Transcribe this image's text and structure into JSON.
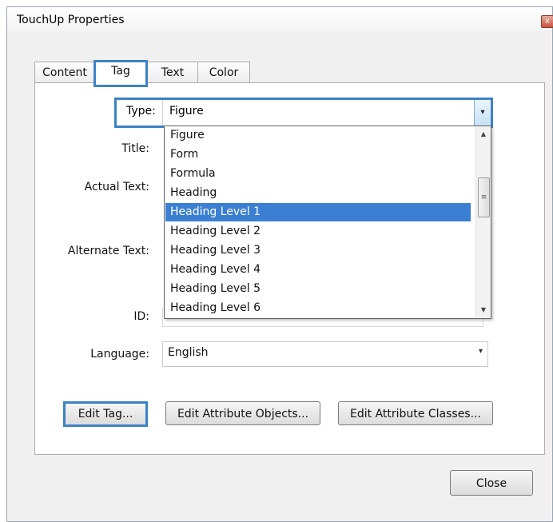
{
  "window": {
    "title": "TouchUp Properties",
    "close_glyph": "x"
  },
  "tabs": [
    {
      "label": "Content",
      "active": false
    },
    {
      "label": "Tag",
      "active": true
    },
    {
      "label": "Text",
      "active": false
    },
    {
      "label": "Color",
      "active": false
    }
  ],
  "form": {
    "type_label": "Type:",
    "type_value": "Figure",
    "title_label": "Title:",
    "actual_text_label": "Actual Text:",
    "alternate_text_label": "Alternate Text:",
    "id_label": "ID:",
    "language_label": "Language:",
    "language_value": "English"
  },
  "type_dropdown": {
    "items": [
      "Figure",
      "Form",
      "Formula",
      "Heading",
      "Heading Level 1",
      "Heading Level 2",
      "Heading Level 3",
      "Heading Level 4",
      "Heading Level 5",
      "Heading Level 6"
    ],
    "selected": "Heading Level 1"
  },
  "buttons": {
    "edit_tag": "Edit Tag...",
    "edit_attribute_objects": "Edit Attribute Objects...",
    "edit_attribute_classes": "Edit Attribute Classes...",
    "close": "Close"
  },
  "colors": {
    "highlight": "#3c82c4",
    "selection": "#3a7fd2"
  },
  "icons": {
    "chevron": "▾",
    "scroll_up": "▲",
    "scroll_down": "▼",
    "thumb_grip": "≡"
  }
}
